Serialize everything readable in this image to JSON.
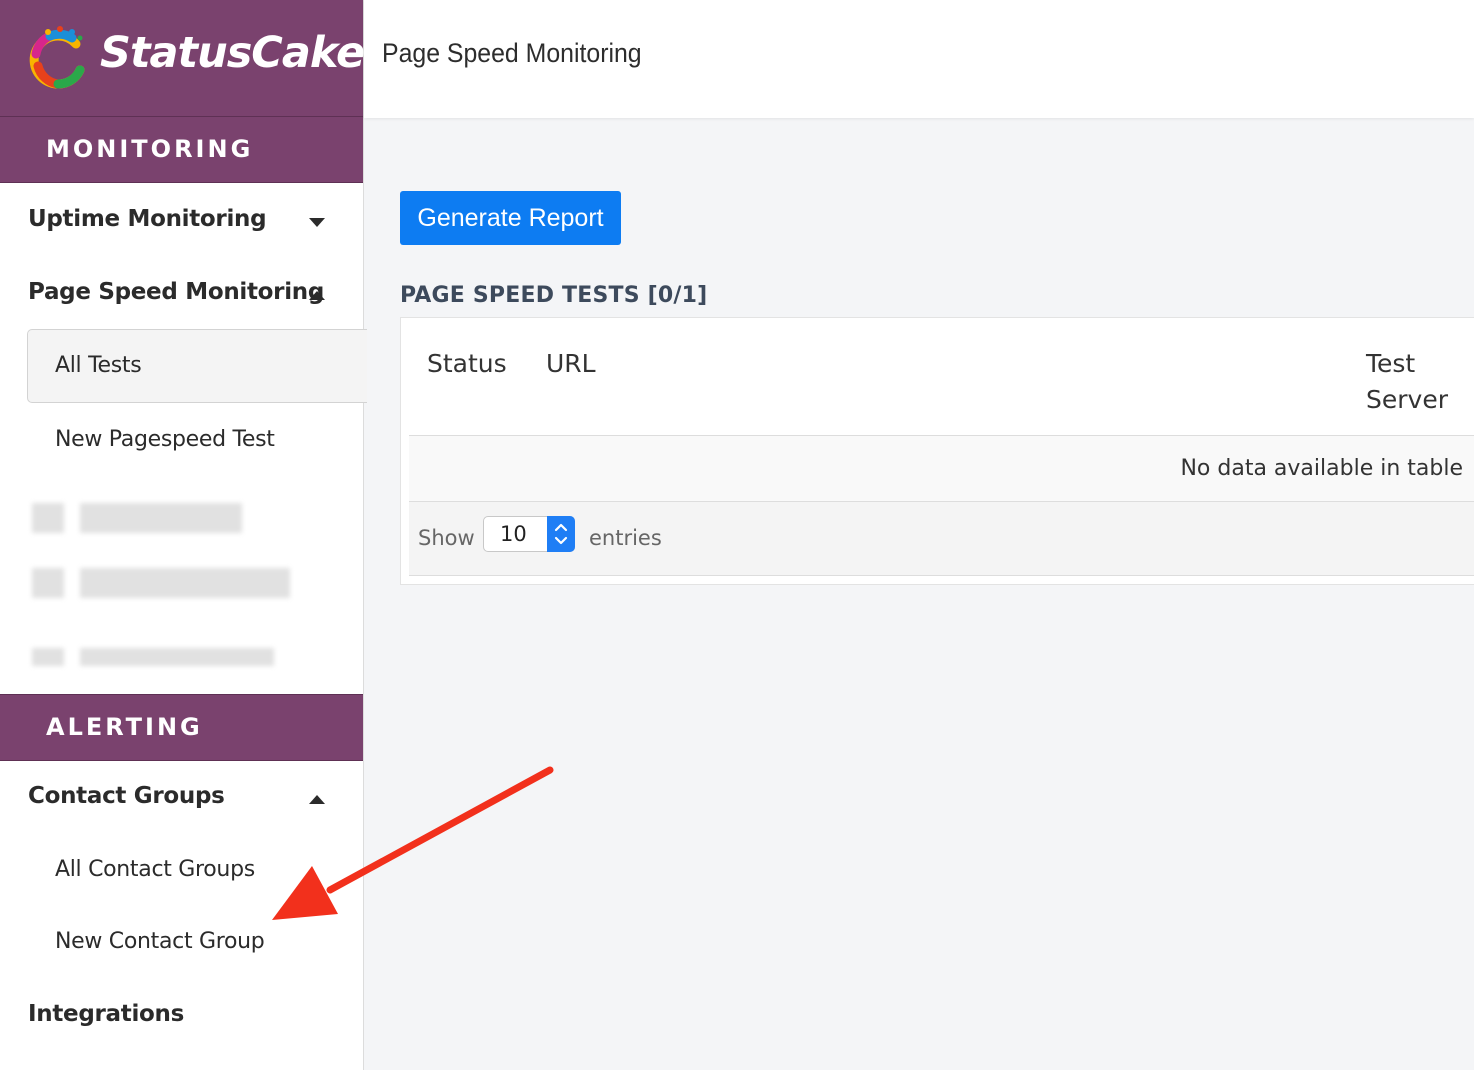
{
  "app": {
    "brand": "StatusCake",
    "logo_icon": "statuscake-logo-icon"
  },
  "header": {
    "title": "Page Speed Monitoring"
  },
  "sidebar": {
    "sections": [
      {
        "label": "MONITORING"
      },
      {
        "label": "ALERTING"
      }
    ],
    "monitoring": {
      "uptime": {
        "label": "Uptime Monitoring",
        "expanded": false
      },
      "pagespeed": {
        "label": "Page Speed Monitoring",
        "expanded": true
      },
      "pagespeed_items": [
        {
          "label": "All Tests",
          "active": true
        },
        {
          "label": "New Pagespeed Test",
          "active": false
        }
      ]
    },
    "alerting": {
      "contact_groups": {
        "label": "Contact Groups",
        "expanded": true
      },
      "contact_group_items": [
        {
          "label": "All Contact Groups"
        },
        {
          "label": "New Contact Group"
        }
      ],
      "integrations": {
        "label": "Integrations"
      }
    }
  },
  "main": {
    "generate_report_label": "Generate Report",
    "tests_heading": "PAGE SPEED TESTS [0/1]",
    "table": {
      "columns": [
        "Status",
        "URL",
        "Test Server"
      ],
      "empty_text": "No data available in table",
      "show_label": "Show",
      "page_size": "10",
      "entries_label": "entries"
    }
  },
  "colors": {
    "brand_purple": "#7a426e",
    "primary_blue": "#0d7cf2",
    "annotation_arrow": "#f2301c"
  }
}
